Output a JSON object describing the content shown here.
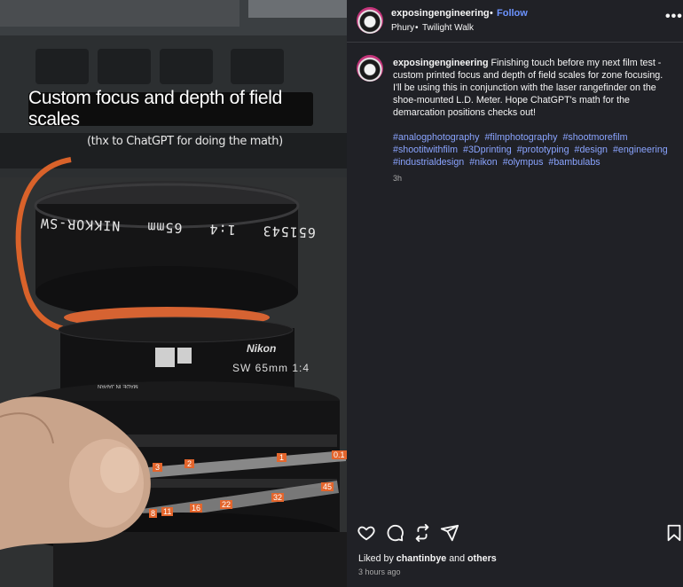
{
  "media": {
    "caption_title": "Custom focus and depth of field scales",
    "caption_sub": "(thx to ChatGPT for doing the math)",
    "lens_engraving": "651543   1:4   65mm   NIKKOR-SW",
    "lens_brand": "Nikon",
    "lens_model": "SW 65mm 1:4",
    "made_in": "MADE IN JAPAN",
    "scale_top": [
      "3",
      "2",
      "1",
      "0.1"
    ],
    "scale_bottom": [
      "8",
      "11",
      "16",
      "22",
      "32",
      "45"
    ]
  },
  "header": {
    "username": "exposingengineering",
    "dot": "•",
    "follow_label": "Follow",
    "audio_artist": "Phury",
    "audio_dot": "•",
    "audio_track": "Twilight Walk",
    "more_label": "•••"
  },
  "post": {
    "username": "exposingengineering",
    "text": "Finishing touch before my next film test - custom printed focus and depth of field scales for zone focusing. I'll be using this in conjunction with the laser rangefinder on the shoe-mounted L.D. Meter. Hope ChatGPT's math for the demarcation positions checks out!",
    "hashtags": [
      "#analogphotography",
      "#filmphotography",
      "#shootmorefilm",
      "#shootitwithfilm",
      "#3Dprinting",
      "#prototyping",
      "#design",
      "#engineering",
      "#industrialdesign",
      "#nikon",
      "#olympus",
      "#bambulabs"
    ],
    "relative_time": "3h"
  },
  "footer": {
    "liked_by_prefix": "Liked by",
    "liked_by_user": "chantinbye",
    "liked_by_and": "and",
    "liked_by_others": "others",
    "posted": "3 hours ago"
  },
  "colors": {
    "panel_bg": "#202126",
    "follow": "#6c93ff",
    "hashtag": "#8aa4ff",
    "scale_orange": "#e3652c"
  },
  "icons": [
    "heart-icon",
    "comment-icon",
    "repost-icon",
    "share-icon",
    "bookmark-icon",
    "more-icon"
  ]
}
